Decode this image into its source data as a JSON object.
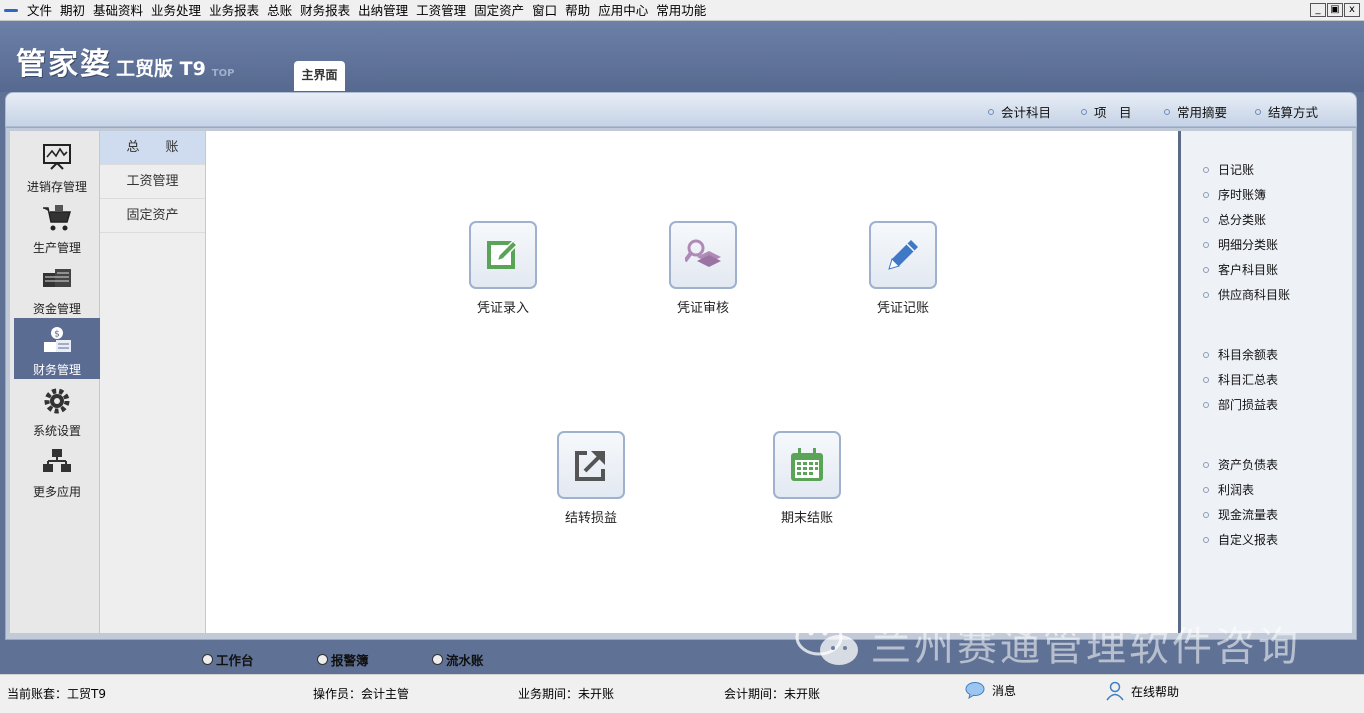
{
  "menu": {
    "items": [
      "文件",
      "期初",
      "基础资料",
      "业务处理",
      "业务报表",
      "总账",
      "财务报表",
      "出纳管理",
      "工资管理",
      "固定资产",
      "窗口",
      "帮助",
      "应用中心",
      "常用功能"
    ],
    "window_buttons": [
      "_",
      "▣",
      "x"
    ]
  },
  "brand": {
    "main": "管家婆",
    "sub": "工贸版 T9",
    "tag": "TOP"
  },
  "main_tab": "主界面",
  "toolbar": {
    "links": [
      "会计科目",
      "项　目",
      "常用摘要",
      "结算方式"
    ]
  },
  "sidebar": {
    "items": [
      {
        "label": "进销存管理",
        "icon": "monitor-chart-icon"
      },
      {
        "label": "生产管理",
        "icon": "cart-icon"
      },
      {
        "label": "资金管理",
        "icon": "money-stack-icon"
      },
      {
        "label": "财务管理",
        "icon": "finance-coins-icon",
        "active": true
      },
      {
        "label": "系统设置",
        "icon": "gear-icon"
      },
      {
        "label": "更多应用",
        "icon": "network-icon"
      }
    ]
  },
  "subnav": {
    "items": [
      "总　　账",
      "工资管理",
      "固定资产"
    ],
    "active_index": 0
  },
  "functions": [
    {
      "label": "凭证录入",
      "icon": "edit-icon"
    },
    {
      "label": "凭证审核",
      "icon": "audit-search-icon"
    },
    {
      "label": "凭证记账",
      "icon": "pencil-icon"
    },
    {
      "label": "结转损益",
      "icon": "export-icon"
    },
    {
      "label": "期末结账",
      "icon": "calendar-icon"
    }
  ],
  "right_panel": {
    "group1": [
      "日记账",
      "序时账簿",
      "总分类账",
      "明细分类账",
      "客户科目账",
      "供应商科目账"
    ],
    "group2": [
      "科目余额表",
      "科目汇总表",
      "部门损益表"
    ],
    "group3": [
      "资产负债表",
      "利润表",
      "现金流量表",
      "自定义报表"
    ]
  },
  "bottom_tabs": [
    "工作台",
    "报警簿",
    "流水账"
  ],
  "watermark": "兰州赛通管理软件咨询",
  "status": {
    "account": "当前账套：工贸T9",
    "operator": "操作员：会计主管",
    "business_period": "业务期间：未开账",
    "accounting_period": "会计期间：未开账",
    "message": "消息",
    "help": "在线帮助"
  },
  "colors": {
    "accent": "#5b6c93",
    "header": "#6d80a8",
    "tile_border": "#9eb2cf"
  }
}
